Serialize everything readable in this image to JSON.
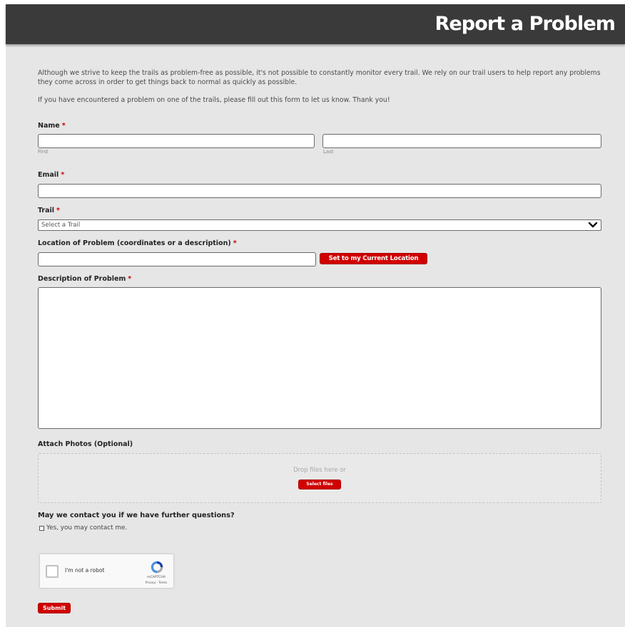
{
  "header": {
    "title": "Report a Problem"
  },
  "intro": {
    "paragraph_1": "Although we strive to keep the trails as problem-free as possible, it's not possible to constantly monitor every trail. We rely on our trail users to help report any problems they come across in order to get things back to normal as quickly as possible.",
    "paragraph_2": "If you have encountered a problem on one of the trails, please fill out this form to let us know. Thank you!"
  },
  "form": {
    "required_mark": "*",
    "name": {
      "label": "Name",
      "first_sublabel": "First",
      "last_sublabel": "Last",
      "first_value": "",
      "last_value": ""
    },
    "email": {
      "label": "Email",
      "value": ""
    },
    "trail": {
      "label": "Trail",
      "selected": "Select a Trail"
    },
    "location": {
      "label": "Location of Problem (coordinates or a description)",
      "value": "",
      "button_label": "Set to my Current Location"
    },
    "description": {
      "label": "Description of Problem",
      "value": ""
    },
    "photos": {
      "label": "Attach Photos (Optional)",
      "drop_text": "Drop files here or",
      "button_label": "Select files"
    },
    "contact": {
      "question": "May we contact you if we have further questions?",
      "option_label": "Yes, you may contact me.",
      "checked": false
    },
    "recaptcha": {
      "label": "I'm not a robot",
      "brand": "reCAPTCHA",
      "links": "Privacy - Terms"
    },
    "submit_label": "Submit"
  },
  "colors": {
    "header_bg": "#3a3a3a",
    "page_bg": "#e6e6e6",
    "accent_red": "#d00000",
    "required_red": "#cc0000"
  },
  "icons": {
    "trail_dropdown": "chevron-down-icon",
    "recaptcha": "recaptcha-logo-icon"
  }
}
